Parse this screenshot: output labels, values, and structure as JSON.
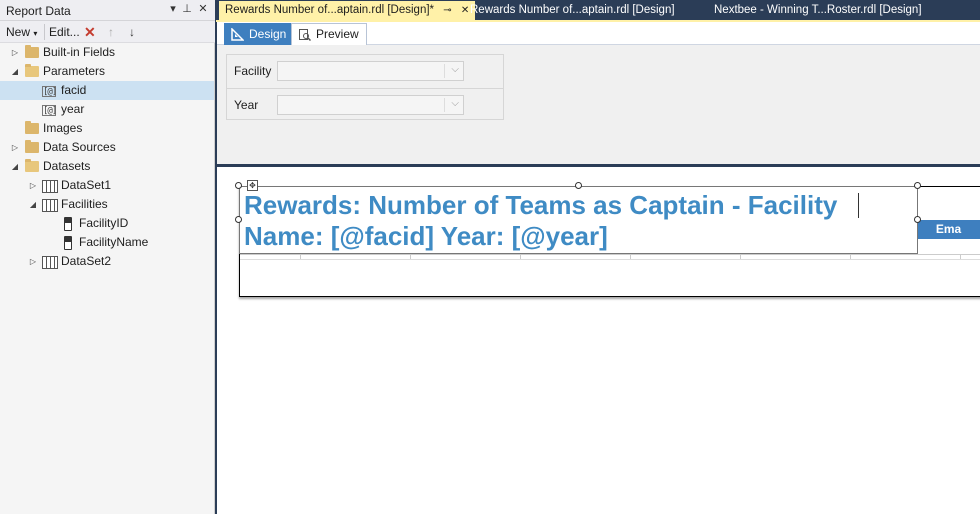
{
  "report_data_pane": {
    "title": "Report Data",
    "buttons": {
      "dropdown": "▾",
      "pin": "⊥",
      "close": "✕"
    },
    "toolbar": {
      "new_label": "New",
      "edit_label": "Edit...",
      "delete": "✕",
      "up": "↑",
      "down": "↓"
    },
    "tree": [
      {
        "label": "Built-in Fields",
        "icon": "folder-icon",
        "expander": "▷"
      },
      {
        "label": "Parameters",
        "icon": "folder-open-icon",
        "expander": "◢"
      },
      {
        "label": "facid",
        "icon": "parameter-icon",
        "selected": true
      },
      {
        "label": "year",
        "icon": "parameter-icon"
      },
      {
        "label": "Images",
        "icon": "folder-icon"
      },
      {
        "label": "Data Sources",
        "icon": "folder-icon",
        "expander": "▷"
      },
      {
        "label": "Datasets",
        "icon": "folder-open-icon",
        "expander": "◢"
      },
      {
        "label": "DataSet1",
        "icon": "dataset-icon",
        "expander": "▷"
      },
      {
        "label": "Facilities",
        "icon": "dataset-icon",
        "expander": "◢"
      },
      {
        "label": "FacilityID",
        "icon": "field-icon"
      },
      {
        "label": "FacilityName",
        "icon": "field-icon"
      },
      {
        "label": "DataSet2",
        "icon": "dataset-icon",
        "expander": "▷"
      }
    ],
    "param_icon_text": "[@]"
  },
  "document_tabs": [
    {
      "label": "Rewards Number of...aptain.rdl [Design]*",
      "active": true,
      "pin": "⊸",
      "close": "✕"
    },
    {
      "label": "Rewards Number of...aptain.rdl [Design]"
    },
    {
      "label": "Nextbee - Winning T...Roster.rdl [Design]"
    }
  ],
  "view_tabs": {
    "design_label": "Design",
    "preview_label": "Preview"
  },
  "parameters_panel": [
    {
      "label": "Facility",
      "value": ""
    },
    {
      "label": "Year",
      "value": ""
    }
  ],
  "report": {
    "title_text": "Rewards: Number of Teams as Captain - Facility Name: [@facid] Year: [@year]",
    "column_header_partial": "Ema",
    "move_glyph": "✥"
  },
  "colors": {
    "accent_blue": "#3e7fbf",
    "title_blue": "#3f8bc4",
    "active_tab": "#fff1a8",
    "frame_dark": "#2b3d57"
  }
}
